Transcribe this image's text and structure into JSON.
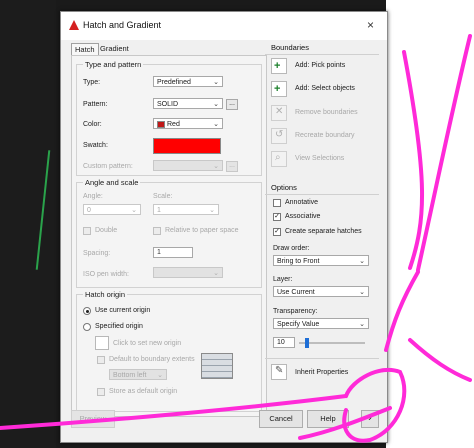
{
  "window": {
    "title": "Hatch and Gradient",
    "close_symbol": "×"
  },
  "tabs": [
    {
      "label": "Hatch"
    },
    {
      "label": "Gradient"
    }
  ],
  "type_pattern": {
    "title": "Type and pattern",
    "type_label": "Type:",
    "type_value": "Predefined",
    "pattern_label": "Pattern:",
    "pattern_value": "SOLID",
    "color_label": "Color:",
    "color_value": "Red",
    "swatch_label": "Swatch:",
    "custom_label": "Custom pattern:",
    "accent_color": "#ff0000"
  },
  "angle_scale": {
    "title": "Angle and scale",
    "angle_label": "Angle:",
    "angle_value": "0",
    "scale_label": "Scale:",
    "scale_value": "1",
    "double_label": "Double",
    "relative_label": "Relative to paper space",
    "spacing_label": "Spacing:",
    "spacing_value": "1",
    "iso_label": "ISO pen width:"
  },
  "hatch_origin": {
    "title": "Hatch origin",
    "use_current": "Use current origin",
    "specified": "Specified origin",
    "click_set": "Click to set new origin",
    "default_extents": "Default to boundary extents",
    "extent_value": "Bottom left",
    "store_default": "Store as default origin"
  },
  "boundaries": {
    "title": "Boundaries",
    "add_pick": "Add: Pick points",
    "add_select": "Add: Select objects",
    "remove": "Remove boundaries",
    "recreate": "Recreate boundary",
    "view": "View Selections"
  },
  "options": {
    "title": "Options",
    "annotative": "Annotative",
    "associative": "Associative",
    "separate": "Create separate hatches",
    "draw_order_label": "Draw order:",
    "draw_order_value": "Bring to Front",
    "layer_label": "Layer:",
    "layer_value": "Use Current",
    "transparency_label": "Transparency:",
    "transparency_value": "Specify Value",
    "transparency_number": "10",
    "transparency_level": 0.1
  },
  "inherit": {
    "label": "Inherit Properties"
  },
  "footer": {
    "preview": "Preview",
    "cancel": "Cancel",
    "help": "Help",
    "more_symbol": "›"
  }
}
